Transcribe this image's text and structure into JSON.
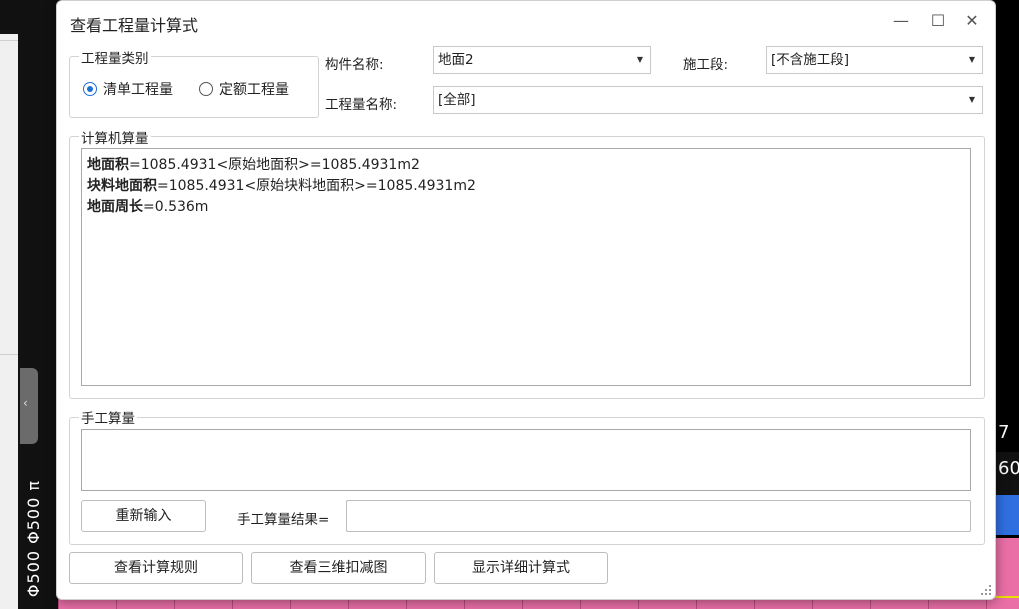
{
  "background": {
    "handle_glyph": "‹",
    "vertical_text": "Φ500 Φ500 π",
    "right_num1": "7",
    "right_num2": "60"
  },
  "dialog": {
    "title": "查看工程量计算式",
    "controls": {
      "minimize": "—",
      "maximize": "☐",
      "close": "✕"
    },
    "category": {
      "legend": "工程量类别",
      "options": [
        {
          "label": "清单工程量",
          "selected": true
        },
        {
          "label": "定额工程量",
          "selected": false
        }
      ]
    },
    "component": {
      "label": "构件名称:",
      "value": "地面2"
    },
    "stage": {
      "label": "施工段:",
      "value": "[不含施工段]"
    },
    "quantity": {
      "label": "工程量名称:",
      "value": "[全部]"
    },
    "computer_calc": {
      "legend": "计算机算量",
      "lines": [
        {
          "name": "地面积",
          "expr": "=1085.4931<原始地面积>=1085.4931m2"
        },
        {
          "name": "块料地面积",
          "expr": "=1085.4931<原始块料地面积>=1085.4931m2"
        },
        {
          "name": "地面周长",
          "expr": "=0.536m"
        }
      ]
    },
    "manual_calc": {
      "legend": "手工算量",
      "reenter_button": "重新输入",
      "result_label": "手工算量结果=",
      "result_value": ""
    },
    "buttons": {
      "view_rules": "查看计算规则",
      "view_3d": "查看三维扣减图",
      "show_detail": "显示详细计算式"
    }
  },
  "colors": {
    "accent": "#1e6fd9",
    "grid_pink": "#e96fa6"
  }
}
